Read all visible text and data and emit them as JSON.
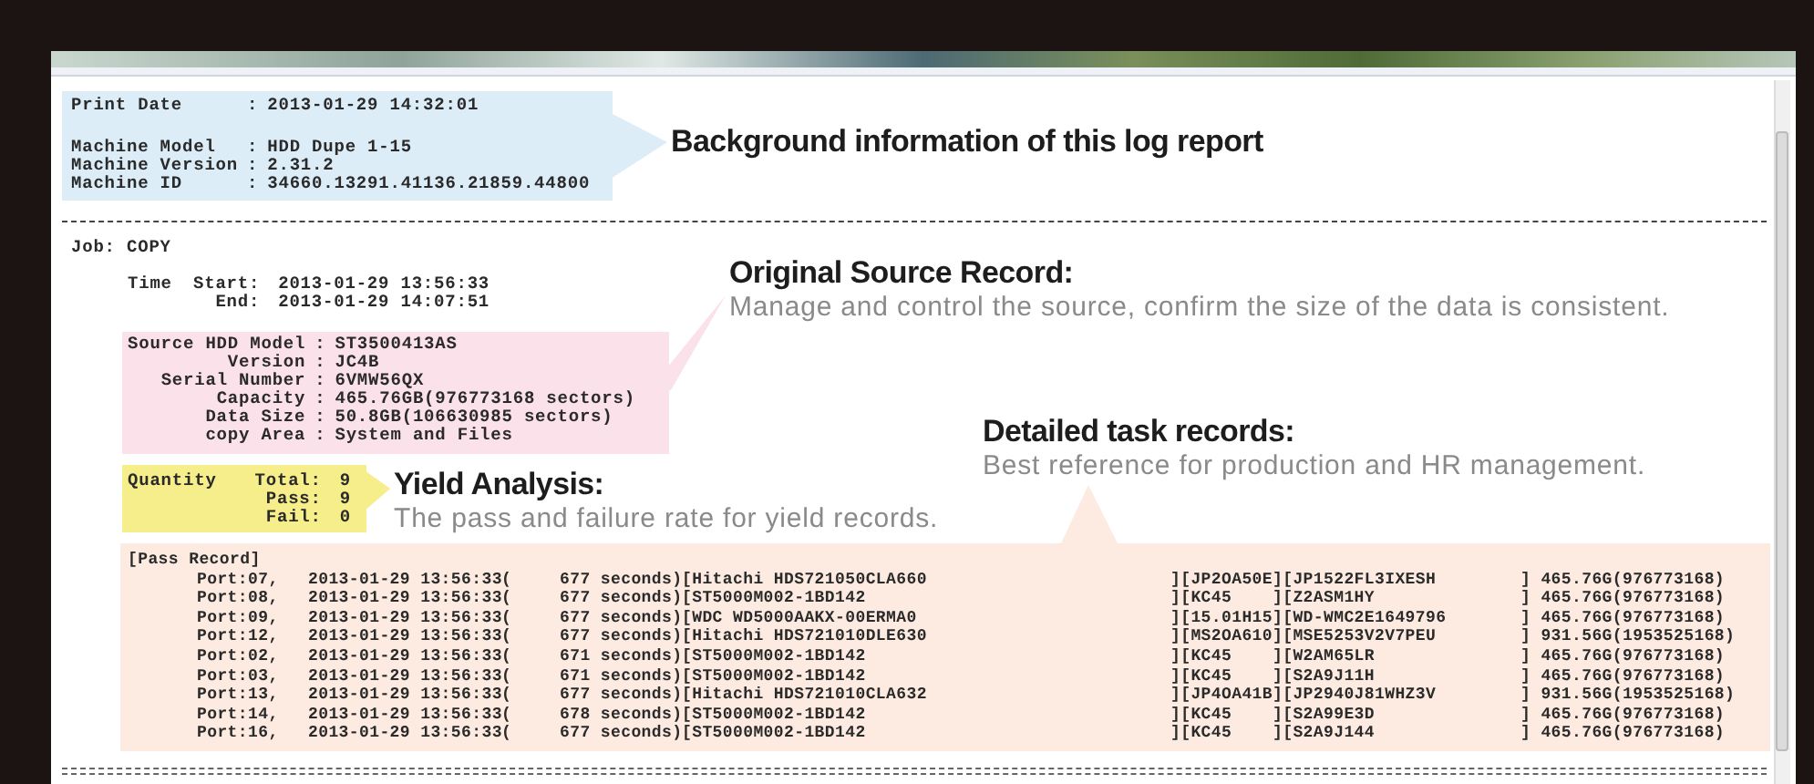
{
  "header": {
    "separator": ":",
    "lines": [
      {
        "label": "Print Date",
        "value": "2013-01-29 14:32:01"
      },
      {
        "label": "Machine Model",
        "value": "HDD Dupe 1-15"
      },
      {
        "label": "Machine Version",
        "value": "2.31.2"
      },
      {
        "label": "Machine ID",
        "value": "34660.13291.41136.21859.44800"
      }
    ]
  },
  "job": {
    "line": "Job: COPY",
    "time": {
      "label": "Time",
      "rows": [
        {
          "label": "Start:",
          "value": "2013-01-29 13:56:33"
        },
        {
          "label": "End:",
          "value": "2013-01-29 14:07:51"
        }
      ]
    }
  },
  "source": {
    "separator": ":",
    "lines": [
      {
        "label": "Source HDD Model",
        "value": "ST3500413AS"
      },
      {
        "label": "Version",
        "value": "JC4B"
      },
      {
        "label": "Serial Number",
        "value": "6VMW56QX"
      },
      {
        "label": "Capacity",
        "value": "465.76GB(976773168 sectors)"
      },
      {
        "label": "Data Size",
        "value": "50.8GB(106630985 sectors)"
      },
      {
        "label": "copy Area",
        "value": "System and Files"
      }
    ]
  },
  "quantity": {
    "label": "Quantity",
    "rows": [
      {
        "label": "Total:",
        "value": "9"
      },
      {
        "label": "Pass:",
        "value": "9"
      },
      {
        "label": "Fail:",
        "value": "0"
      }
    ]
  },
  "pass_record": {
    "title": "[Pass Record]",
    "rows": [
      {
        "port": "Port:07,",
        "time": "2013-01-29 13:56:33",
        "paren": "(",
        "seconds": "677 seconds)",
        "model": "[Hitachi HDS721050CLA660",
        "firmware": "][JP2OA50E",
        "serial": "][JP1522FL3IXESH",
        "capacity": "] 465.76G(976773168)"
      },
      {
        "port": "Port:08,",
        "time": "2013-01-29 13:56:33",
        "paren": "(",
        "seconds": "677 seconds)",
        "model": "[ST5000M002-1BD142",
        "firmware": "][KC45",
        "serial": "][Z2ASM1HY",
        "capacity": "] 465.76G(976773168)"
      },
      {
        "port": "Port:09,",
        "time": "2013-01-29 13:56:33",
        "paren": "(",
        "seconds": "677 seconds)",
        "model": "[WDC WD5000AAKX-00ERMA0",
        "firmware": "][15.01H15",
        "serial": "][WD-WMC2E1649796",
        "capacity": "] 465.76G(976773168)"
      },
      {
        "port": "Port:12,",
        "time": "2013-01-29 13:56:33",
        "paren": "(",
        "seconds": "677 seconds)",
        "model": "[Hitachi HDS721010DLE630",
        "firmware": "][MS2OA610",
        "serial": "][MSE5253V2V7PEU",
        "capacity": "] 931.56G(1953525168)"
      },
      {
        "port": "Port:02,",
        "time": "2013-01-29 13:56:33",
        "paren": "(",
        "seconds": "671 seconds)",
        "model": "[ST5000M002-1BD142",
        "firmware": "][KC45",
        "serial": "][W2AM65LR",
        "capacity": "] 465.76G(976773168)"
      },
      {
        "port": "Port:03,",
        "time": "2013-01-29 13:56:33",
        "paren": "(",
        "seconds": "671 seconds)",
        "model": "[ST5000M002-1BD142",
        "firmware": "][KC45",
        "serial": "][S2A9J11H",
        "capacity": "] 465.76G(976773168)"
      },
      {
        "port": "Port:13,",
        "time": "2013-01-29 13:56:33",
        "paren": "(",
        "seconds": "677 seconds)",
        "model": "[Hitachi HDS721010CLA632",
        "firmware": "][JP4OA41B",
        "serial": "][JP2940J81WHZ3V",
        "capacity": "] 931.56G(1953525168)"
      },
      {
        "port": "Port:14,",
        "time": "2013-01-29 13:56:33",
        "paren": "(",
        "seconds": "678 seconds)",
        "model": "[ST5000M002-1BD142",
        "firmware": "][KC45",
        "serial": "][S2A99E3D",
        "capacity": "] 465.76G(976773168)"
      },
      {
        "port": "Port:16,",
        "time": "2013-01-29 13:56:33",
        "paren": "(",
        "seconds": "677 seconds)",
        "model": "[ST5000M002-1BD142",
        "firmware": "][KC45",
        "serial": "][S2A9J144",
        "capacity": "] 465.76G(976773168)"
      }
    ]
  },
  "callouts": [
    {
      "title": "Background information of this log report"
    },
    {
      "title": "Original Source Record:",
      "text": "Manage and control the source, confirm the size of the data is consistent."
    },
    {
      "title": "Detailed task records:",
      "text": "Best reference for production and HR management."
    },
    {
      "title": "Yield Analysis:",
      "text": "The pass and failure rate for yield records."
    }
  ]
}
